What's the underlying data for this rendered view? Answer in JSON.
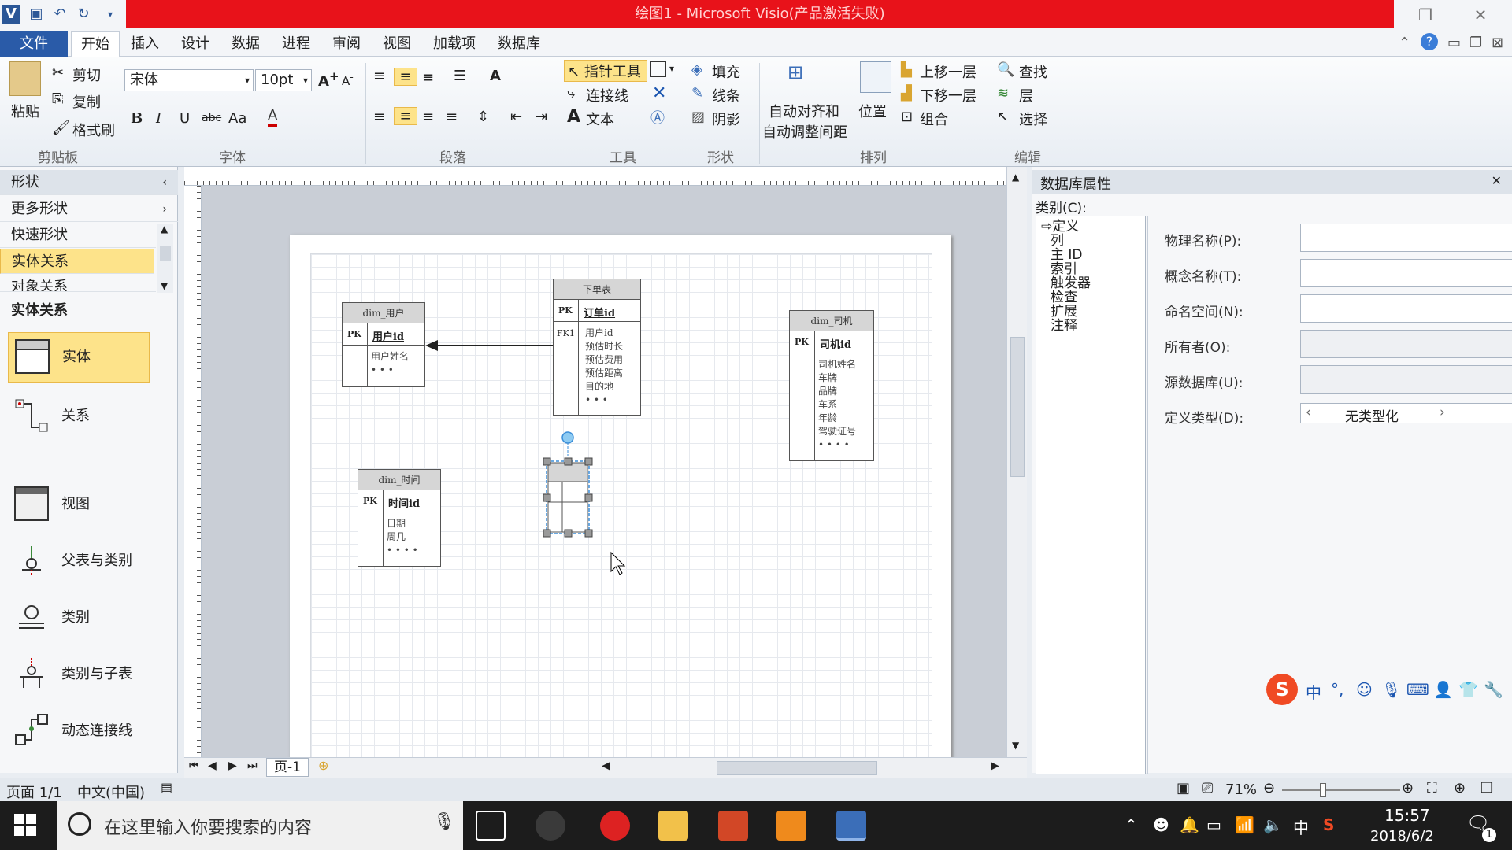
{
  "titlebar": {
    "title": "绘图1 - Microsoft Visio(产品激活失败)",
    "restore": "❐",
    "close": "✕"
  },
  "tabs": [
    "文件",
    "开始",
    "插入",
    "设计",
    "数据",
    "进程",
    "审阅",
    "视图",
    "加载项",
    "数据库"
  ],
  "ribbon": {
    "clipboard": {
      "paste": "粘贴",
      "cut": "剪切",
      "copy": "复制",
      "format_painter": "格式刷",
      "group": "剪贴板"
    },
    "font": {
      "name": "宋体",
      "size": "10pt",
      "group": "字体"
    },
    "paragraph": {
      "group": "段落"
    },
    "tools": {
      "pointer": "指针工具",
      "connector": "连接线",
      "text": "文本",
      "group": "工具"
    },
    "shape": {
      "fill": "填充",
      "line": "线条",
      "shadow": "阴影",
      "group": "形状"
    },
    "arrange": {
      "auto_align": "自动对齐和",
      "auto_space": "自动调整间距",
      "position": "位置",
      "bring_forward": "上移一层",
      "send_backward": "下移一层",
      "group_btn": "组合",
      "group": "排列"
    },
    "editing": {
      "find": "查找",
      "layers": "层",
      "select": "选择",
      "group": "编辑"
    }
  },
  "left_panel": {
    "header": "形状",
    "more_shapes": "更多形状",
    "quick_shapes": "快速形状",
    "entity_relationship": "实体关系",
    "object_relationship": "对象关系",
    "section_title": "实体关系",
    "shapes": [
      "实体",
      "关系",
      "视图",
      "父表与类别",
      "类别",
      "类别与子表",
      "动态连接线"
    ]
  },
  "diagram": {
    "entities": [
      {
        "title": "dim_用户",
        "pk": "PK",
        "pk_name": "用户id",
        "fields": [
          "用户姓名",
          "• • •"
        ]
      },
      {
        "title": "下单表",
        "pk": "PK",
        "pk_name": "订单id",
        "fk": "FK1",
        "fields": [
          "用户id",
          "预估时长",
          "预估费用",
          "预估距离",
          "目的地",
          "• • •"
        ]
      },
      {
        "title": "dim_司机",
        "pk": "PK",
        "pk_name": "司机id",
        "fields": [
          "司机姓名",
          "车牌",
          "品牌",
          "车系",
          "年龄",
          "驾驶证号",
          "• • • •"
        ]
      },
      {
        "title": "dim_时间",
        "pk": "PK",
        "pk_name": "时间id",
        "fields": [
          "日期",
          "周几",
          "• • • •"
        ]
      }
    ]
  },
  "page_tab": "页-1",
  "right_panel": {
    "title": "数据库属性",
    "category_label": "类别(C):",
    "categories": [
      "定义",
      "列",
      "主 ID",
      "索引",
      "触发器",
      "检查",
      "扩展",
      "注释"
    ],
    "fields": [
      {
        "label": "物理名称(P):",
        "value": ""
      },
      {
        "label": "概念名称(T):",
        "value": ""
      },
      {
        "label": "命名空间(N):",
        "value": ""
      },
      {
        "label": "所有者(O):",
        "value": ""
      },
      {
        "label": "源数据库(U):",
        "value": ""
      },
      {
        "label": "定义类型(D):",
        "value": "无类型化"
      }
    ]
  },
  "statusbar": {
    "page": "页面 1/1",
    "language": "中文(中国)",
    "zoom": "71%"
  },
  "taskbar": {
    "search_placeholder": "在这里输入你要搜索的内容",
    "ime": "中",
    "time": "15:57",
    "date": "2018/6/2",
    "notification_count": "1"
  },
  "colors": {
    "title_red": "#e8121a",
    "file_tab": "#2a5ba8",
    "highlight": "#fde38a"
  }
}
